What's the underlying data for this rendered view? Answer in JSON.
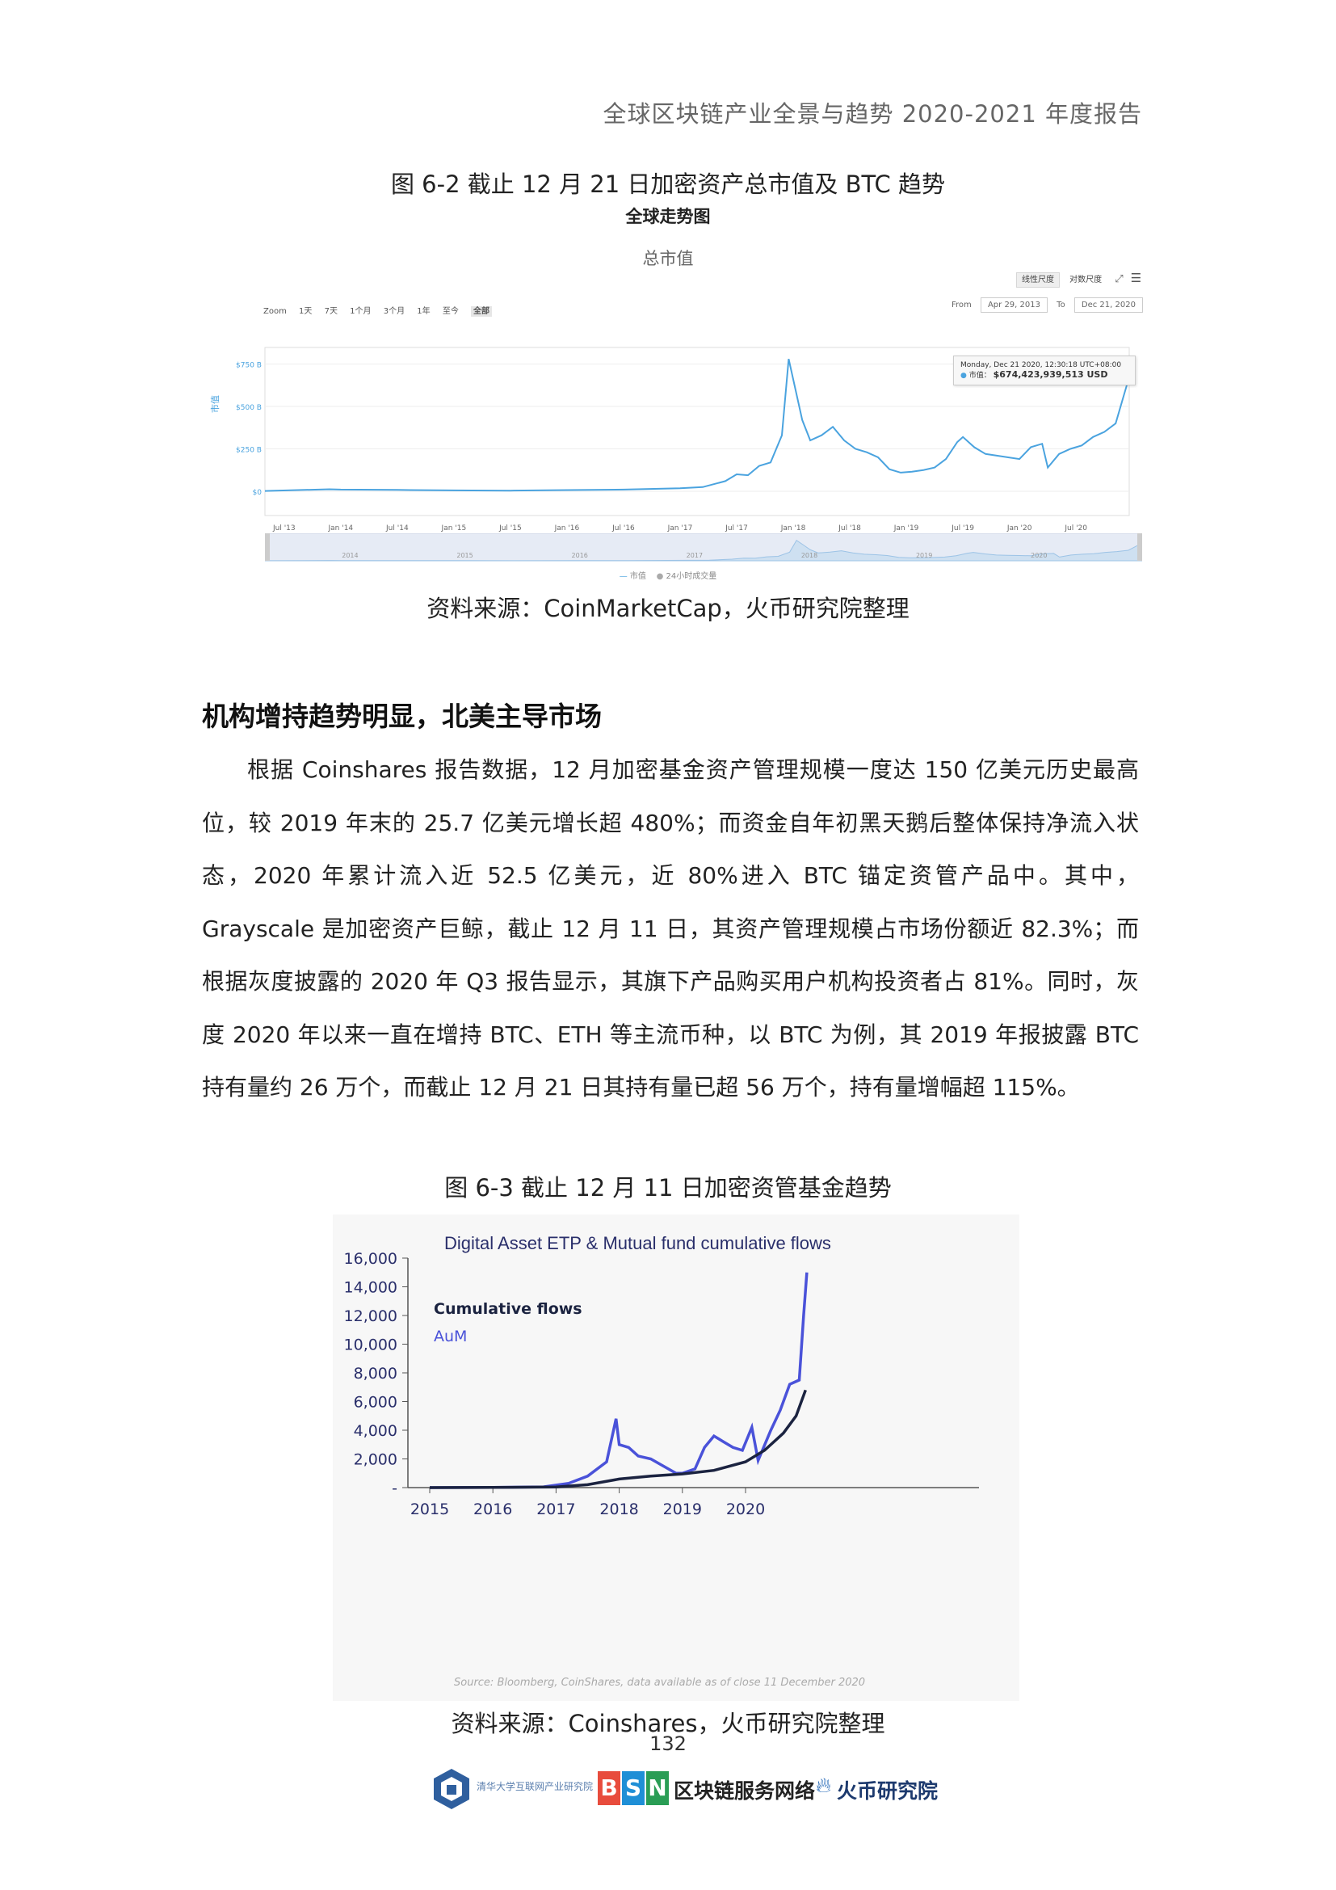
{
  "header": {
    "title": "全球区块链产业全景与趋势 2020-2021 年度报告"
  },
  "figure1": {
    "caption": "图 6-2 截止 12 月 21 日加密资产总市值及 BTC 趋势",
    "source": "资料来源：CoinMarketCap，火币研究院整理"
  },
  "figure2": {
    "caption": "图 6-3 截止 12 月 11 日加密资管基金趋势",
    "source": "资料来源：Coinshares，火币研究院整理"
  },
  "section": {
    "title": "机构增持趋势明显，北美主导市场"
  },
  "body": {
    "paragraph": "根据 Coinshares 报告数据，12 月加密基金资产管理规模一度达 150 亿美元历史最高位，较 2019 年末的 25.7 亿美元增长超 480%；而资金自年初黑天鹅后整体保持净流入状态，2020 年累计流入近 52.5 亿美元，近 80%进入 BTC 锚定资管产品中。其中，Grayscale 是加密资产巨鲸，截止 12 月 11 日，其资产管理规模占市场份额近 82.3%；而根据灰度披露的 2020 年 Q3 报告显示，其旗下产品购买用户机构投资者占 81%。同时，灰度 2020 年以来一直在增持 BTC、ETH 等主流币种，以 BTC 为例，其 2019 年报披露 BTC 持有量约 26 万个，而截止 12 月 21 日其持有量已超 56 万个，持有量增幅超 115%。"
  },
  "page_number": "132",
  "logos": {
    "tsinghua": "清华大学互联网产业研究院",
    "bsn_letters": "BSN",
    "bsn_name": "区块链服务网络",
    "huobi": "火币研究院"
  },
  "chart1_ui": {
    "zoom_label": "Zoom",
    "zoom_options": [
      "1天",
      "7天",
      "1个月",
      "3个月",
      "1年",
      "至今",
      "全部"
    ],
    "from_label": "From",
    "from_value": "Apr 29, 2013",
    "to_label": "To",
    "to_value": "Dec 21, 2020",
    "btn_linear": "线性尺度",
    "btn_log": "对数尺度",
    "tooltip_date": "Monday, Dec 21 2020, 12:30:18 UTC+08:00",
    "tooltip_series": "市值",
    "tooltip_value": "$674,423,939,513 USD",
    "nav_years": [
      "2014",
      "2015",
      "2016",
      "2017",
      "2018",
      "2019",
      "2020"
    ],
    "legend_cap": "市值",
    "legend_vol": "24小时成交量"
  },
  "chart_data": [
    {
      "type": "line",
      "title": "全球走势图",
      "subtitle": "总市值",
      "ylabel": "市值",
      "yticks": [
        "$0",
        "$250 B",
        "$500 B",
        "$750 B"
      ],
      "ylim": [
        0,
        800
      ],
      "xticks": [
        "Jul '13",
        "Jan '14",
        "Jul '14",
        "Jan '15",
        "Jul '15",
        "Jan '16",
        "Jul '16",
        "Jan '17",
        "Jul '17",
        "Jan '18",
        "Jul '18",
        "Jan '19",
        "Jul '19",
        "Jan '20",
        "Jul '20"
      ],
      "series": [
        {
          "name": "市值",
          "color": "#4aa3df",
          "x": [
            2013.33,
            2013.9,
            2014.0,
            2014.5,
            2015.0,
            2015.5,
            2016.0,
            2016.5,
            2017.0,
            2017.2,
            2017.4,
            2017.5,
            2017.6,
            2017.7,
            2017.8,
            2017.9,
            2017.96,
            2018.02,
            2018.08,
            2018.15,
            2018.25,
            2018.35,
            2018.45,
            2018.55,
            2018.65,
            2018.75,
            2018.85,
            2018.95,
            2019.05,
            2019.15,
            2019.25,
            2019.35,
            2019.45,
            2019.5,
            2019.6,
            2019.7,
            2019.8,
            2019.9,
            2020.0,
            2020.1,
            2020.2,
            2020.25,
            2020.35,
            2020.45,
            2020.55,
            2020.65,
            2020.75,
            2020.85,
            2020.92,
            2020.97
          ],
          "values": [
            2,
            12,
            10,
            8,
            5,
            4,
            7,
            10,
            18,
            25,
            60,
            100,
            95,
            150,
            170,
            330,
            780,
            600,
            420,
            300,
            330,
            380,
            300,
            250,
            230,
            200,
            130,
            110,
            115,
            125,
            140,
            190,
            290,
            320,
            260,
            220,
            210,
            200,
            190,
            260,
            280,
            140,
            220,
            250,
            270,
            320,
            350,
            400,
            560,
            674
          ]
        }
      ]
    },
    {
      "type": "line",
      "title": "Digital Asset ETP & Mutual fund cumulative flows",
      "yticks": [
        "-",
        "2,000",
        "4,000",
        "6,000",
        "8,000",
        "10,000",
        "12,000",
        "14,000",
        "16,000"
      ],
      "ylim": [
        0,
        16000
      ],
      "xticks": [
        "2015",
        "2016",
        "2017",
        "2018",
        "2019",
        "2020"
      ],
      "source_note": "Source: Bloomberg, CoinShares, data available as of close 11 December 2020",
      "series": [
        {
          "name": "Cumulative flows",
          "color": "#1b2340",
          "x": [
            2015,
            2016,
            2017,
            2017.5,
            2018,
            2018.5,
            2019,
            2019.5,
            2020,
            2020.3,
            2020.6,
            2020.8,
            2020.95
          ],
          "values": [
            0,
            10,
            40,
            200,
            600,
            800,
            950,
            1200,
            1800,
            2600,
            3800,
            5000,
            6800
          ]
        },
        {
          "name": "AuM",
          "color": "#4a52d9",
          "x": [
            2015,
            2016,
            2016.8,
            2017.2,
            2017.5,
            2017.8,
            2017.95,
            2018.0,
            2018.15,
            2018.3,
            2018.5,
            2018.7,
            2018.9,
            2019.0,
            2019.2,
            2019.35,
            2019.5,
            2019.65,
            2019.8,
            2019.95,
            2020.1,
            2020.2,
            2020.4,
            2020.55,
            2020.7,
            2020.85,
            2020.92,
            2020.97
          ],
          "values": [
            0,
            10,
            50,
            300,
            800,
            1800,
            4800,
            3000,
            2800,
            2200,
            2000,
            1500,
            1000,
            1000,
            1300,
            2800,
            3600,
            3200,
            2800,
            2600,
            4200,
            1900,
            4000,
            5400,
            7200,
            7500,
            12000,
            15000
          ]
        }
      ]
    }
  ]
}
